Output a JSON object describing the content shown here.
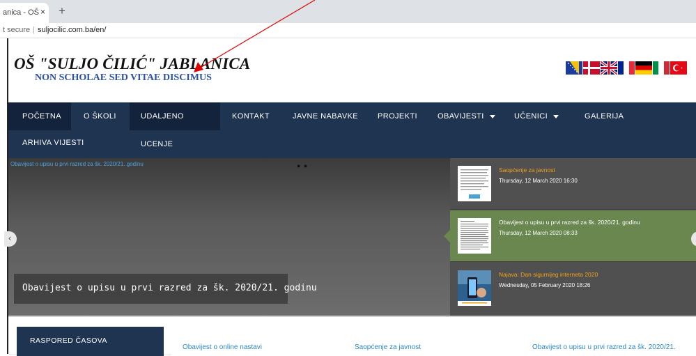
{
  "browser": {
    "tab_title": "anica - OŠ",
    "tab_close": "×",
    "new_tab": "+",
    "security": "t secure",
    "url": "suljocilic.com.ba/en/"
  },
  "header": {
    "title": "OŠ \"SULJO ČILIĆ\" JABLANICA",
    "motto": "NON SCHOLAE SED VITAE DISCIMUS",
    "flags": [
      "bosnia-flag",
      "denmark-flag",
      "uk-flag",
      "france-flag",
      "germany-flag",
      "italy-flag",
      "turkey-flag"
    ]
  },
  "nav": {
    "items": [
      {
        "label": "POČETNA",
        "active": true
      },
      {
        "label": "O ŠKOLI"
      },
      {
        "label": "UDALJENO UCENJE",
        "active": true
      },
      {
        "label": "KONTAKT"
      },
      {
        "label": "JAVNE NABAVKE"
      },
      {
        "label": "PROJEKTI"
      },
      {
        "label": "OBAVIJESTI",
        "dropdown": true
      },
      {
        "label": "UČENICI",
        "dropdown": true
      },
      {
        "label": "GALERIJA"
      },
      {
        "label": "ARHIVA VIJESTI"
      }
    ]
  },
  "slider": {
    "image_alt": "Obavijest o upisu u prvi razred za šk. 2020/21. godinu",
    "dots": "● ●",
    "caption": "Obavijest o upisu u prvi razred za šk. 2020/21. godinu",
    "prev_icon": "chevron-left-icon",
    "items": [
      {
        "title": "Saopćenje za javnost",
        "date": "Thursday, 12 March 2020 16:30"
      },
      {
        "title": "Obavijest o upisu u prvi razred za šk. 2020/21. godinu",
        "date": "Thursday, 12 March 2020 08:33"
      },
      {
        "title": "Najava: Dan sigurnijeg interneta 2020",
        "date": "Wednesday, 05 February 2020 18:26"
      }
    ]
  },
  "lower": {
    "schedule_label": "RASPORED ČASOVA",
    "links": [
      "Obavijest o online nastavi",
      "Saopćenje za javnost",
      "Obavijest o upisu u prvi razred za šk. 2020/21."
    ]
  },
  "colors": {
    "nav_bg": "#1f3451",
    "active_slide": "#69874f",
    "link": "#2a88c9",
    "annotation_arrow": "#e00000"
  }
}
